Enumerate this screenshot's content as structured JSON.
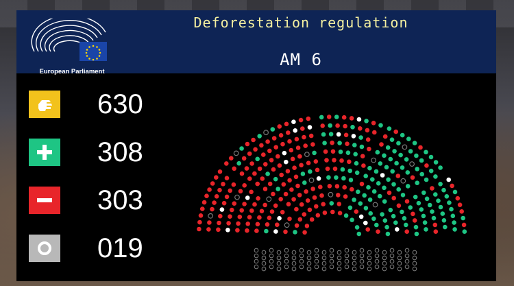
{
  "header": {
    "logo_label": "European Parliament",
    "title": "Deforestation regulation",
    "amendment": "AM 6"
  },
  "results": [
    {
      "kind": "present",
      "icon": "hand-raised-icon",
      "color": "#f2c21c",
      "value": "630"
    },
    {
      "kind": "for",
      "icon": "plus-icon",
      "color": "#1ec584",
      "value": "308"
    },
    {
      "kind": "against",
      "icon": "minus-icon",
      "color": "#e8252a",
      "value": "303"
    },
    {
      "kind": "abstain",
      "icon": "circle-icon",
      "color": "#b8b8b8",
      "value": "019"
    }
  ],
  "colors": {
    "header_bg": "#0e2455",
    "panel_bg": "#000000",
    "seat_for": "#1ec584",
    "seat_against": "#e8252a",
    "seat_abstain": "#ffffff",
    "seat_absent": "#777777"
  }
}
